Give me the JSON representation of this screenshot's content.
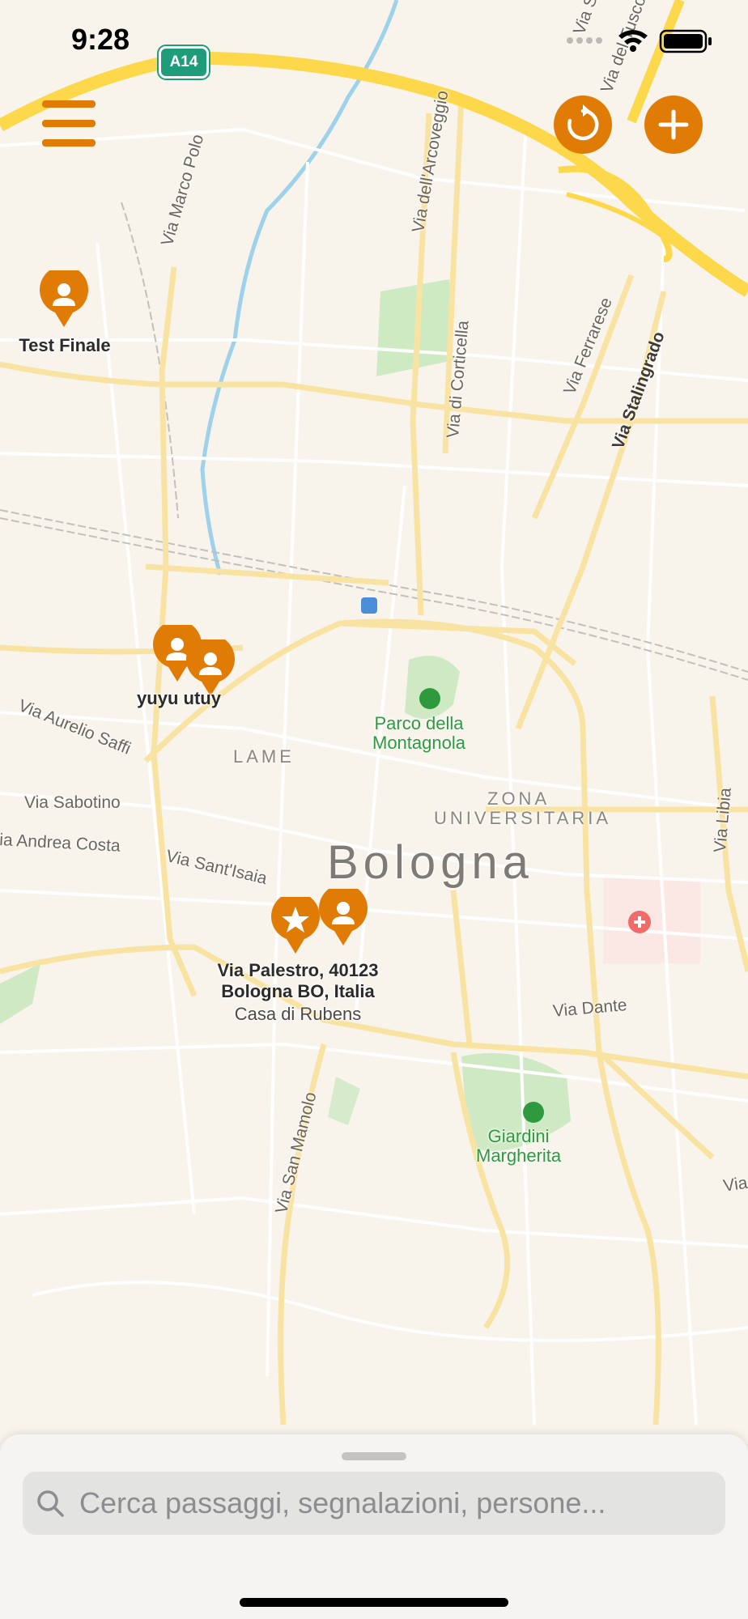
{
  "status_bar": {
    "time": "9:28"
  },
  "map": {
    "highway_shield": "A14",
    "city": "Bologna",
    "districts": [
      "LAME",
      "ZONA",
      "UNIVERSITARIA"
    ],
    "streets": {
      "via_marco_polo": "Via Marco Polo",
      "via_arcoveggio": "Via dell'Arcoveggio",
      "via_corticella": "Via di Corticella",
      "via_ferrarese": "Via Ferrarese",
      "via_stalingrado": "Via Stalingrado",
      "via_tuscolano": "Via del Tusco",
      "via_s": "Via S",
      "via_aurelio_saffi": "Via Aurelio Saffi",
      "via_sabotino": "Via Sabotino",
      "via_andrea_costa": "ia Andrea Costa",
      "via_sant_isaia": "Via Sant'Isaia",
      "via_dante": "Via Dante",
      "via_libia": "Via Libia",
      "via_san_mamolo": "Via San Mamolo",
      "via_edge": "Via"
    },
    "parks": {
      "montagnola_1": "Parco della",
      "montagnola_2": "Montagnola",
      "giardini_1": "Giardini",
      "giardini_2": "Margherita"
    },
    "pins": {
      "test_finale": "Test Finale",
      "yuyu": "yuyu utuy",
      "address_line1": "Via Palestro, 40123",
      "address_line2": "Bologna BO, Italia",
      "casa_rubens": "Casa di Rubens"
    }
  },
  "controls": {
    "menu_icon": "hamburger-icon",
    "refresh_icon": "refresh-icon",
    "add_icon": "plus-icon"
  },
  "search": {
    "placeholder": "Cerca passaggi, segnalazioni, persone..."
  },
  "colors": {
    "accent": "#e07c06",
    "highway": "#fcd84a",
    "park": "#c7e8bd",
    "background": "#f8f4ec"
  }
}
